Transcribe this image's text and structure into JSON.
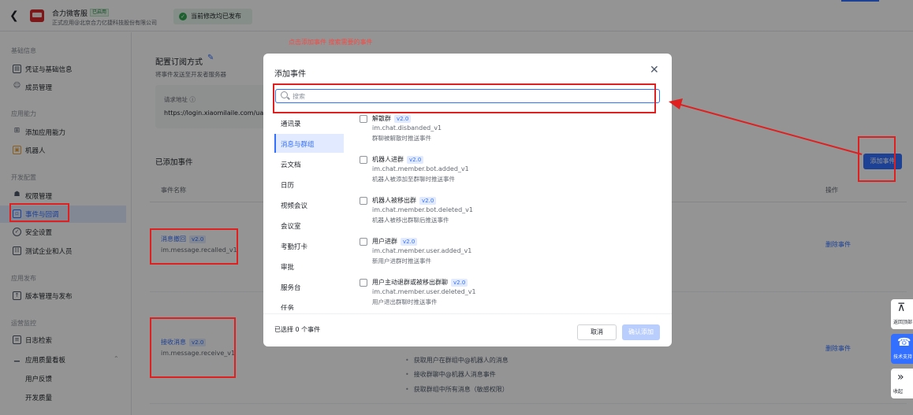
{
  "topbar": {
    "app_name": "合力微客服",
    "app_badge": "已启用",
    "company": "正式应用@北京合力亿捷科技股份有限公司",
    "status": "当前修改均已发布"
  },
  "sidebar": {
    "sections": [
      {
        "title": "基础信息"
      },
      {
        "title": "应用能力"
      },
      {
        "title": "开发配置"
      },
      {
        "title": "应用发布"
      },
      {
        "title": "运营监控"
      }
    ],
    "items": [
      {
        "label": "凭证与基础信息",
        "icon": "credential-icon"
      },
      {
        "label": "成员管理",
        "icon": "members-icon"
      },
      {
        "label": "添加应用能力",
        "icon": "add-capability-icon"
      },
      {
        "label": "机器人",
        "icon": "robot-icon"
      },
      {
        "label": "权限管理",
        "icon": "permission-icon"
      },
      {
        "label": "事件与回调",
        "icon": "event-icon"
      },
      {
        "label": "安全设置",
        "icon": "shield-icon"
      },
      {
        "label": "测试企业和人员",
        "icon": "test-icon"
      },
      {
        "label": "版本管理与发布",
        "icon": "version-icon"
      },
      {
        "label": "日志检索",
        "icon": "log-icon"
      },
      {
        "label": "应用质量看板",
        "icon": "chart-icon"
      },
      {
        "label": "用户反馈",
        "icon": ""
      },
      {
        "label": "开发质量",
        "icon": ""
      }
    ]
  },
  "main": {
    "config_title": "配置订阅方式",
    "config_desc": "将事件发送至开发者服务器",
    "request_label": "请求地址 ⓘ",
    "request_url": "https://login.xiaomilaile.com/uap",
    "added_title": "已添加事件",
    "add_button": "添加事件",
    "col_name": "事件名称",
    "col_op": "操作",
    "events": [
      {
        "name": "消息撤回",
        "version": "v2.0",
        "code": "im.message.recalled_v1",
        "action": "删除事件"
      },
      {
        "name": "接收消息",
        "version": "v2.0",
        "code": "im.message.receive_v1",
        "action": "删除事件"
      }
    ],
    "bullets": [
      "获取用户在群组中@机器人的消息",
      "接收群聊中@机器人消息事件",
      "获取群组中所有消息（敏感权限）"
    ]
  },
  "annotation": {
    "note": "点击添加事件 搜索需要的事件"
  },
  "modal": {
    "title": "添加事件",
    "search_placeholder": "搜索",
    "categories": [
      "通讯录",
      "消息与群组",
      "云文档",
      "日历",
      "视频会议",
      "会议室",
      "考勤打卡",
      "审批",
      "服务台",
      "任务"
    ],
    "active_category": "消息与群组",
    "events": [
      {
        "name": "解散群",
        "version": "v2.0",
        "code": "im.chat.disbanded_v1",
        "desc": "群聊被解散时推送事件"
      },
      {
        "name": "机器人进群",
        "version": "v2.0",
        "code": "im.chat.member.bot.added_v1",
        "desc": "机器人被添加至群聊时推送事件"
      },
      {
        "name": "机器人被移出群",
        "version": "v2.0",
        "code": "im.chat.member.bot.deleted_v1",
        "desc": "机器人被移出群聊后推送事件"
      },
      {
        "name": "用户进群",
        "version": "v2.0",
        "code": "im.chat.member.user.added_v1",
        "desc": "新用户进群时推送事件"
      },
      {
        "name": "用户主动退群或被移出群聊",
        "version": "v2.0",
        "code": "im.chat.member.user.deleted_v1",
        "desc": "用户退出群聊时推送事件"
      }
    ],
    "selected_count": "已选择 0 个事件",
    "cancel": "取消",
    "confirm": "确认添加"
  },
  "floating": [
    {
      "label": "返回顶部",
      "icon": "back-to-top-icon"
    },
    {
      "label": "技术支持",
      "icon": "headset-icon"
    },
    {
      "label": "收起",
      "icon": "collapse-icon"
    }
  ],
  "colors": {
    "accent": "#3370ff",
    "annotation_red": "#e02020",
    "status_green": "#34a853"
  }
}
